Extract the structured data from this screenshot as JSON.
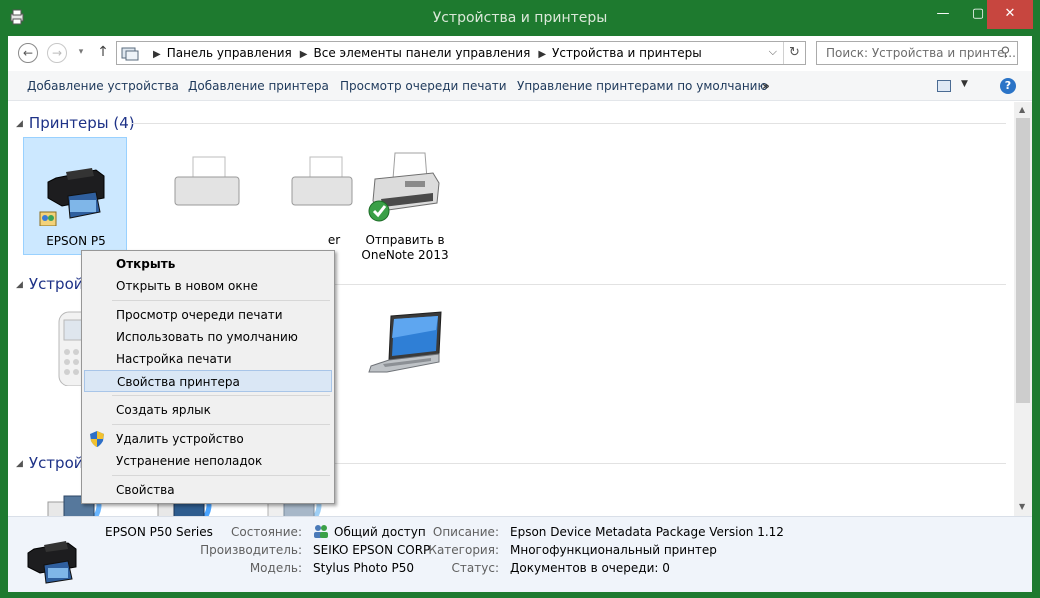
{
  "window": {
    "title": "Устройства и принтеры",
    "controls": {
      "minimize": "—",
      "maximize": "▢",
      "close": "✕"
    }
  },
  "navigation": {
    "breadcrumbs": [
      "Панель управления",
      "Все элементы панели управления",
      "Устройства и принтеры"
    ],
    "search_placeholder": "Поиск: Устройства и принте..."
  },
  "commands": {
    "add_device": "Добавление устройства",
    "add_printer": "Добавление принтера",
    "print_queue": "Просмотр очереди печати",
    "default_printers": "Управление принтерами по умолчанию",
    "more": "»"
  },
  "groups": {
    "printers": {
      "title": "Принтеры (4)"
    },
    "devices": {
      "title": "Устрой"
    },
    "multimedia": {
      "title": "Устройства мультимедиа (3)"
    }
  },
  "printers": [
    {
      "label": "EPSON P5",
      "selected": true,
      "icon": "printer-icon"
    },
    {
      "label": "",
      "icon": "printer-icon"
    },
    {
      "label": "er",
      "icon": "printer-icon"
    },
    {
      "label": "Отправить в OneNote 2013",
      "icon": "printer-default-icon",
      "is_default": true
    }
  ],
  "context_menu": {
    "items": [
      {
        "label": "Открыть",
        "bold": true
      },
      {
        "label": "Открыть в новом окне"
      },
      {
        "label": "Просмотр очереди печати"
      },
      {
        "label": "Использовать по умолчанию"
      },
      {
        "label": "Настройка печати"
      },
      {
        "label": "Свойства принтера",
        "highlighted": true
      },
      {
        "label": "Создать ярлык"
      },
      {
        "label": "Удалить устройство",
        "icon": "uac-shield-icon"
      },
      {
        "label": "Устранение неполадок"
      },
      {
        "label": "Свойства"
      }
    ]
  },
  "details": {
    "name": "EPSON P50 Series",
    "state_label": "Состояние:",
    "state_value": "Общий доступ",
    "manufacturer_label": "Производитель:",
    "manufacturer_value": "SEIKO EPSON CORP",
    "model_label": "Модель:",
    "model_value": "Stylus Photo P50",
    "description_label": "Описание:",
    "description_value": "Epson Device Metadata Package Version 1.12",
    "category_label": "Категория:",
    "category_value": "Многофункциональный принтер",
    "status_label": "Статус:",
    "status_value": "Документов в очереди: 0"
  },
  "colors": {
    "window_frame": "#1e7a2f",
    "close_button": "#c7463f",
    "group_header": "#1e3287",
    "selection": "#cce8ff",
    "menu_highlight": "#dae7f5"
  }
}
